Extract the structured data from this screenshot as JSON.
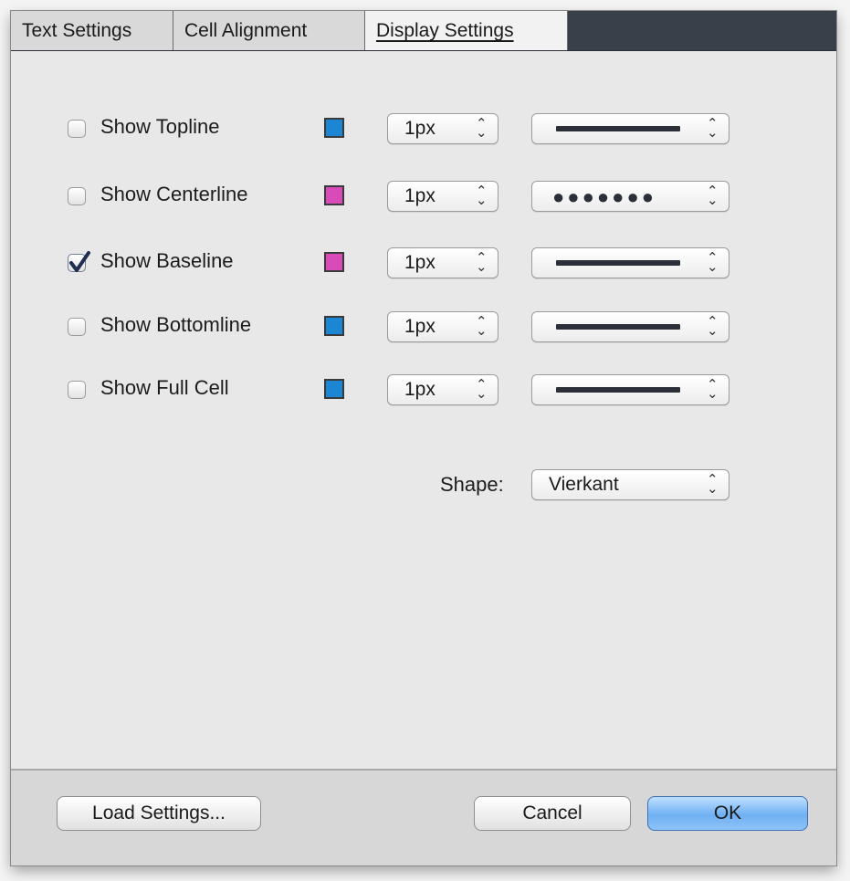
{
  "tabs": [
    {
      "label": "Text Settings",
      "active": false
    },
    {
      "label": "Cell Alignment",
      "active": false
    },
    {
      "label": "Display Settings",
      "active": true
    }
  ],
  "rows": [
    {
      "label": "Show Topline",
      "checked": false,
      "color": "#1a86d4",
      "size": "1px",
      "style": "solid"
    },
    {
      "label": "Show Centerline",
      "checked": false,
      "color": "#d94bb8",
      "size": "1px",
      "style": "dotted",
      "dots": "●●●●●●●"
    },
    {
      "label": "Show Baseline",
      "checked": true,
      "color": "#d94bb8",
      "size": "1px",
      "style": "solid"
    },
    {
      "label": "Show Bottomline",
      "checked": false,
      "color": "#1a86d4",
      "size": "1px",
      "style": "solid"
    },
    {
      "label": "Show Full Cell",
      "checked": false,
      "color": "#1a86d4",
      "size": "1px",
      "style": "solid"
    }
  ],
  "shape": {
    "label": "Shape:",
    "value": "Vierkant"
  },
  "footer": {
    "load_label": "Load Settings...",
    "cancel_label": "Cancel",
    "ok_label": "OK"
  },
  "icons": {
    "select_arrow": "updown-chevron-icon",
    "check": "checkmark-icon"
  }
}
